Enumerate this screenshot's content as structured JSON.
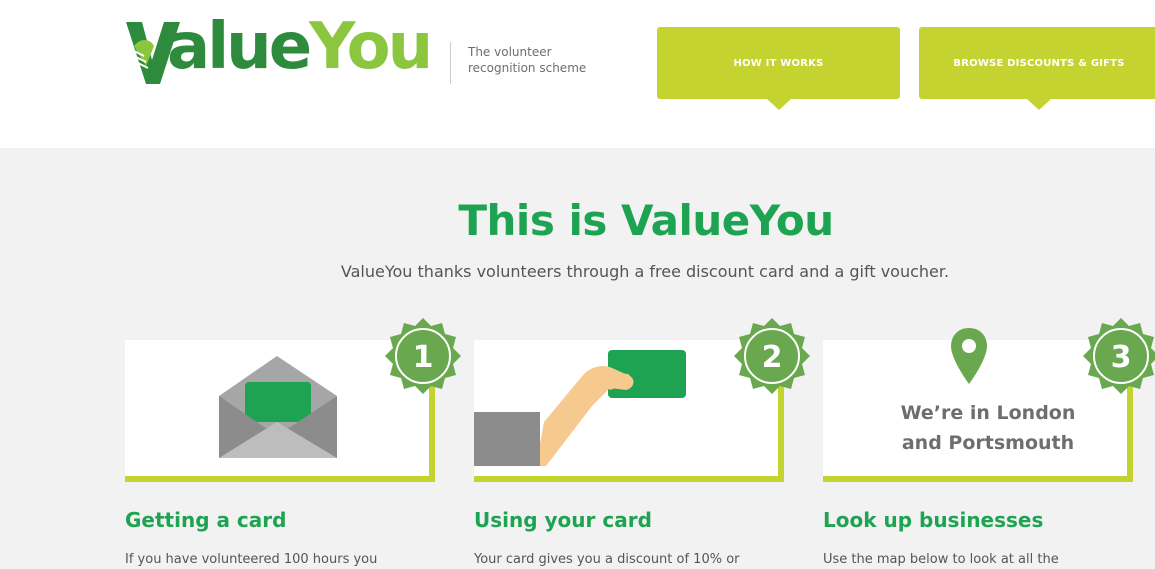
{
  "brand": {
    "logo_v": "V",
    "logo_alue": "alue",
    "logo_you": "You",
    "tagline_line1": "The volunteer",
    "tagline_line2": "recognition scheme",
    "green": "#2e8b3e",
    "lime": "#8cc63f"
  },
  "nav": {
    "how_it_works": "HOW IT WORKS",
    "browse": "BROWSE DISCOUNTS & GIFTS",
    "button_color": "#c5d331"
  },
  "hero": {
    "title": "This is ValueYou",
    "subtitle": "ValueYou thanks volunteers through a free discount card and a gift voucher."
  },
  "steps": [
    {
      "number": "1",
      "title": "Getting a card",
      "text": "If you have volunteered 100 hours you",
      "icon": "envelope-icon"
    },
    {
      "number": "2",
      "title": "Using your card",
      "text": "Your card gives you a discount of 10% or",
      "icon": "hand-card-icon"
    },
    {
      "number": "3",
      "title": "Look up businesses",
      "text": "Use the map below to look at all the",
      "icon": "map-pin-icon",
      "location_line1": "We’re in London",
      "location_line2": "and Portsmouth"
    }
  ]
}
